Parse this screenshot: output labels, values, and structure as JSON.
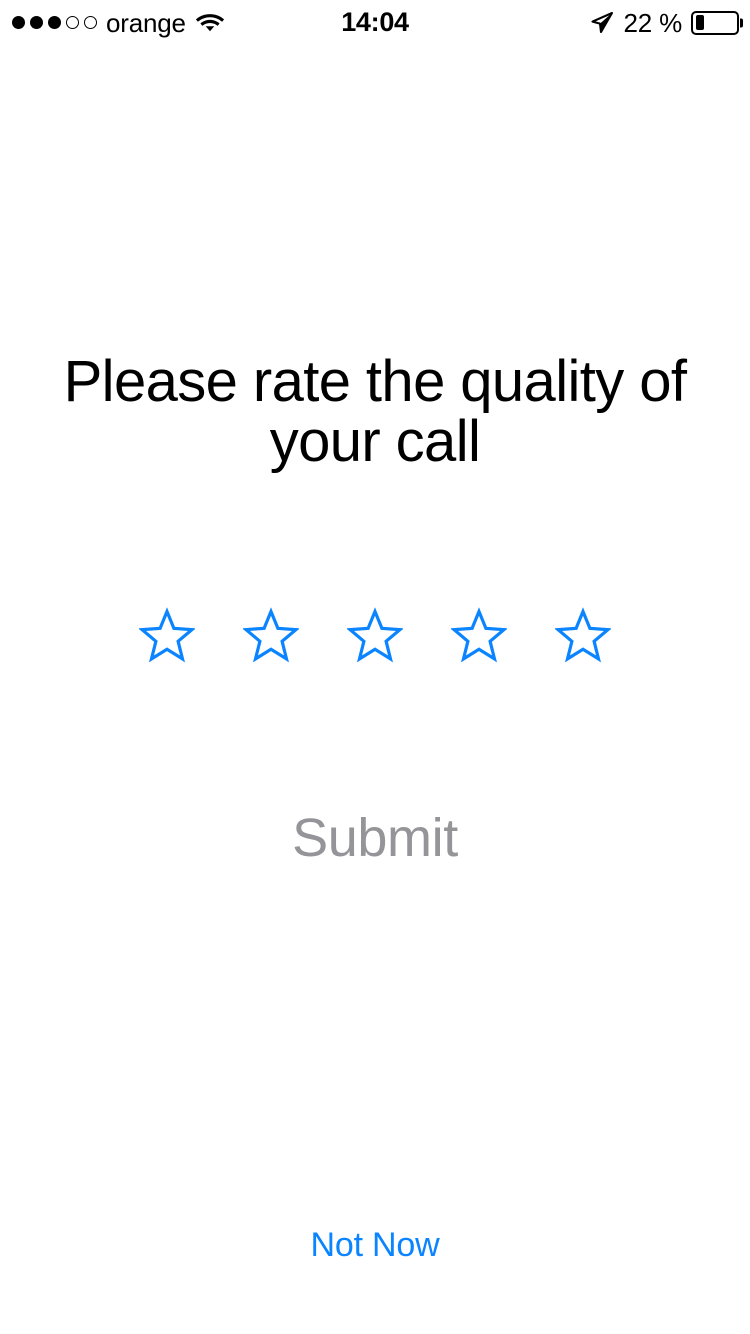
{
  "status_bar": {
    "carrier": "orange",
    "signal_bars_filled": 3,
    "signal_bars_total": 5,
    "wifi_icon": "wifi-icon",
    "time": "14:04",
    "location_icon": "location-arrow-icon",
    "battery_percent_label": "22 %",
    "battery_level": 22,
    "text_color": "#000000"
  },
  "screen": {
    "background_color": "#ffffff",
    "title": "Please rate the quality of your call"
  },
  "rating": {
    "stars_total": 5,
    "stars_selected": 0,
    "star_icon": "star-outline-icon",
    "star_color": "#0a84ff",
    "stars": [
      {
        "value": 1,
        "filled": false
      },
      {
        "value": 2,
        "filled": false
      },
      {
        "value": 3,
        "filled": false
      },
      {
        "value": 4,
        "filled": false
      },
      {
        "value": 5,
        "filled": false
      }
    ]
  },
  "actions": {
    "submit_label": "Submit",
    "submit_color": "#949499",
    "submit_enabled": false,
    "not_now_label": "Not Now",
    "not_now_color": "#0a84ff"
  }
}
